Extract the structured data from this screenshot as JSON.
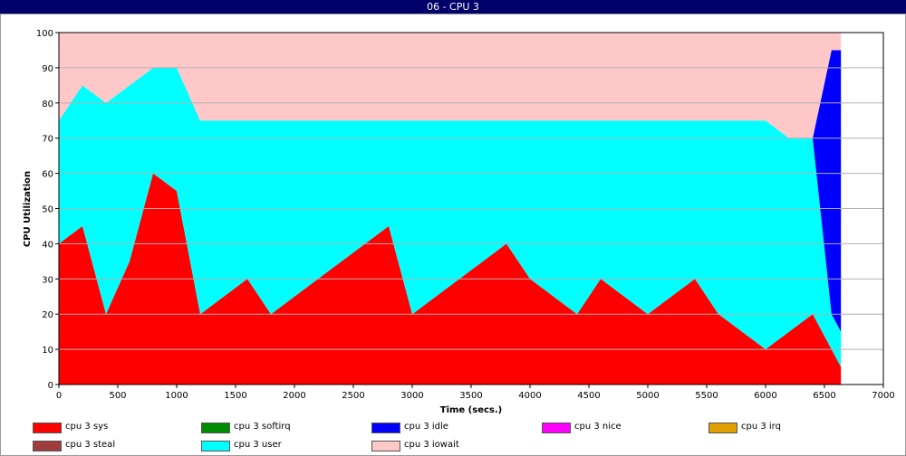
{
  "window": {
    "title": "06 - CPU 3"
  },
  "chart_data": {
    "type": "area",
    "xlabel": "Time (secs.)",
    "ylabel": "CPU Utilization",
    "xlim": [
      0,
      7000
    ],
    "ylim": [
      0,
      100
    ],
    "x_ticks": [
      "0",
      "500",
      "1000",
      "1500",
      "2000",
      "2500",
      "3000",
      "3500",
      "4000",
      "4500",
      "5000",
      "5500",
      "6000",
      "6500",
      "7000"
    ],
    "y_ticks": [
      "0",
      "10",
      "20",
      "30",
      "40",
      "50",
      "60",
      "70",
      "80",
      "90",
      "100"
    ],
    "grid": true,
    "legend_position": "bottom",
    "series": [
      {
        "name": "cpu 3 sys",
        "color": "#ff0000"
      },
      {
        "name": "cpu 3 softirq",
        "color": "#008c00"
      },
      {
        "name": "cpu 3 idle",
        "color": "#0000ff"
      },
      {
        "name": "cpu 3 nice",
        "color": "#ff00ff"
      },
      {
        "name": "cpu 3 irq",
        "color": "#e0a000"
      },
      {
        "name": "cpu 3 steal",
        "color": "#a03c3c"
      },
      {
        "name": "cpu 3 user",
        "color": "#00ffff"
      },
      {
        "name": "cpu 3 iowait",
        "color": "#ffc8c8"
      }
    ],
    "stack_profile": {
      "x": [
        0,
        200,
        400,
        600,
        800,
        1000,
        1200,
        1400,
        1600,
        1800,
        2000,
        2200,
        2400,
        2600,
        2800,
        3000,
        3200,
        3400,
        3600,
        3800,
        4000,
        4200,
        4400,
        4600,
        4800,
        5000,
        5200,
        5400,
        5600,
        5800,
        6000,
        6200,
        6400,
        6560,
        6640
      ],
      "sys": [
        40,
        45,
        20,
        35,
        60,
        55,
        20,
        25,
        30,
        20,
        25,
        30,
        35,
        40,
        45,
        20,
        25,
        30,
        35,
        40,
        30,
        25,
        20,
        30,
        25,
        20,
        25,
        30,
        20,
        15,
        10,
        15,
        20,
        10,
        5
      ],
      "user": [
        35,
        40,
        60,
        50,
        30,
        35,
        55,
        50,
        45,
        55,
        50,
        45,
        40,
        35,
        30,
        55,
        50,
        45,
        40,
        35,
        45,
        50,
        55,
        45,
        50,
        55,
        50,
        45,
        55,
        60,
        65,
        55,
        50,
        10,
        10
      ],
      "idle": [
        0,
        0,
        0,
        0,
        0,
        0,
        0,
        0,
        0,
        0,
        0,
        0,
        0,
        0,
        0,
        0,
        0,
        0,
        0,
        0,
        0,
        0,
        0,
        0,
        0,
        0,
        0,
        0,
        0,
        0,
        0,
        0,
        0,
        75,
        80
      ],
      "iowait": [
        25,
        15,
        20,
        15,
        10,
        10,
        25,
        25,
        25,
        25,
        25,
        25,
        25,
        25,
        25,
        25,
        25,
        25,
        25,
        25,
        25,
        25,
        25,
        25,
        25,
        25,
        25,
        25,
        25,
        25,
        25,
        30,
        30,
        5,
        5
      ]
    }
  }
}
